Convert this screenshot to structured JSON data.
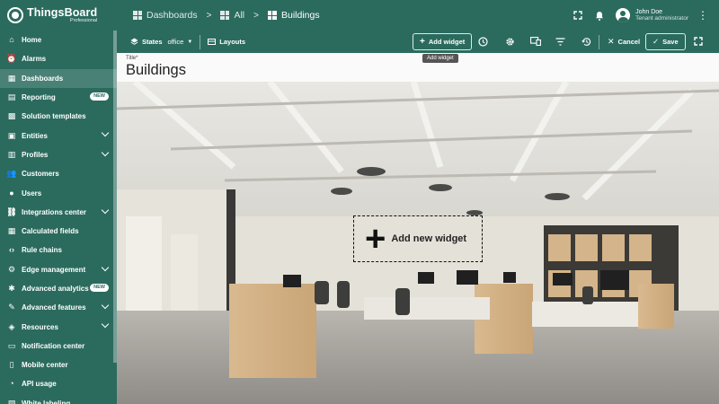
{
  "brand": {
    "name": "ThingsBoard",
    "edition": "Professional"
  },
  "sidebar": {
    "items": [
      {
        "label": "Home",
        "icon": "home-icon"
      },
      {
        "label": "Alarms",
        "icon": "alarm-icon"
      },
      {
        "label": "Dashboards",
        "icon": "dashboard-icon",
        "active": true
      },
      {
        "label": "Reporting",
        "icon": "reporting-icon",
        "badge": "NEW"
      },
      {
        "label": "Solution templates",
        "icon": "templates-icon"
      },
      {
        "label": "Entities",
        "icon": "entities-icon",
        "expand": true
      },
      {
        "label": "Profiles",
        "icon": "profiles-icon",
        "expand": true
      },
      {
        "label": "Customers",
        "icon": "customers-icon"
      },
      {
        "label": "Users",
        "icon": "users-icon"
      },
      {
        "label": "Integrations center",
        "icon": "integrations-icon",
        "expand": true
      },
      {
        "label": "Calculated fields",
        "icon": "calculated-fields-icon"
      },
      {
        "label": "Rule chains",
        "icon": "rule-chains-icon"
      },
      {
        "label": "Edge management",
        "icon": "edge-icon",
        "expand": true
      },
      {
        "label": "Advanced analytics",
        "icon": "analytics-icon",
        "badge": "NEW"
      },
      {
        "label": "Advanced features",
        "icon": "features-icon",
        "expand": true
      },
      {
        "label": "Resources",
        "icon": "resources-icon",
        "expand": true
      },
      {
        "label": "Notification center",
        "icon": "notification-icon"
      },
      {
        "label": "Mobile center",
        "icon": "mobile-icon"
      },
      {
        "label": "API usage",
        "icon": "api-usage-icon"
      },
      {
        "label": "White labeling",
        "icon": "white-labeling-icon"
      }
    ]
  },
  "breadcrumb": [
    {
      "label": "Dashboards"
    },
    {
      "label": "All"
    },
    {
      "label": "Buildings"
    }
  ],
  "user": {
    "name": "John Doe",
    "role": "Tenant administrator"
  },
  "toolbar": {
    "states_label": "States",
    "states_value": "office",
    "layouts_label": "Layouts",
    "add_widget_label": "Add widget",
    "add_widget_tooltip": "Add widget",
    "cancel_label": "Cancel",
    "save_label": "Save"
  },
  "dashboard": {
    "title_label": "Title",
    "title_required": "*",
    "title": "Buildings",
    "add_new_widget_label": "Add new widget"
  },
  "colors": {
    "primary": "#2b6b5e",
    "surface": "#fafafa"
  }
}
